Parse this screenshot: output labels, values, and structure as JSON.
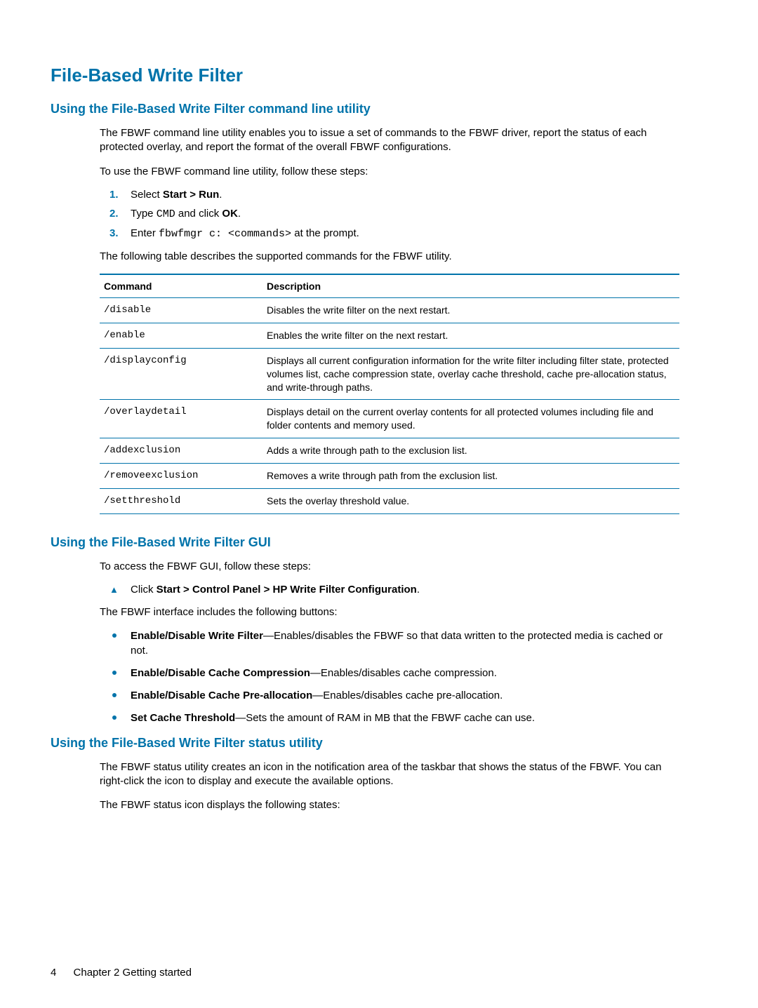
{
  "title": "File-Based Write Filter",
  "section1": {
    "heading": "Using the File-Based Write Filter command line utility",
    "intro": "The FBWF command line utility enables you to issue a set of commands to the FBWF driver, report the status of each protected overlay, and report the format of the overall FBWF configurations.",
    "lead": "To use the FBWF command line utility, follow these steps:",
    "steps": {
      "s1_a": "Select ",
      "s1_b": "Start > Run",
      "s1_c": ".",
      "s2_a": "Type ",
      "s2_code": "CMD",
      "s2_b": " and click ",
      "s2_bold": "OK",
      "s2_c": ".",
      "s3_a": "Enter ",
      "s3_code": "fbwfmgr c: <commands>",
      "s3_b": " at the prompt."
    },
    "table_lead": "The following table describes the supported commands for the FBWF utility.",
    "table": {
      "h1": "Command",
      "h2": "Description",
      "rows": [
        {
          "cmd": "/disable",
          "desc": "Disables the write filter on the next restart."
        },
        {
          "cmd": "/enable",
          "desc": "Enables the write filter on the next restart."
        },
        {
          "cmd": "/displayconfig",
          "desc": "Displays all current configuration information for the write filter including filter state, protected volumes list, cache compression state, overlay cache threshold, cache pre-allocation status, and write-through paths."
        },
        {
          "cmd": "/overlaydetail",
          "desc": "Displays detail on the current overlay contents for all protected volumes including file and folder contents and memory used."
        },
        {
          "cmd": "/addexclusion",
          "desc": "Adds a write through path to the exclusion list."
        },
        {
          "cmd": "/removeexclusion",
          "desc": "Removes a write through path from the exclusion list."
        },
        {
          "cmd": "/setthreshold",
          "desc": "Sets the overlay threshold value."
        }
      ]
    }
  },
  "section2": {
    "heading": "Using the File-Based Write Filter GUI",
    "intro": "To access the FBWF GUI, follow these steps:",
    "tri": {
      "a": "Click ",
      "b": "Start > Control Panel > HP Write Filter Configuration",
      "c": "."
    },
    "lead2": "The FBWF interface includes the following buttons:",
    "bullets": [
      {
        "b": "Enable/Disable Write Filter",
        "t": "—Enables/disables the FBWF so that data written to the protected media is cached or not."
      },
      {
        "b": "Enable/Disable Cache Compression",
        "t": "—Enables/disables cache compression."
      },
      {
        "b": "Enable/Disable Cache Pre-allocation",
        "t": "—Enables/disables cache pre-allocation."
      },
      {
        "b": "Set Cache Threshold",
        "t": "—Sets the amount of RAM in MB that the FBWF cache can use."
      }
    ]
  },
  "section3": {
    "heading": "Using the File-Based Write Filter status utility",
    "p1": "The FBWF status utility creates an icon in the notification area of the taskbar that shows the status of the FBWF. You can right-click the icon to display and execute the available options.",
    "p2": "The FBWF status icon displays the following states:"
  },
  "footer": {
    "page": "4",
    "chapter": "Chapter 2   Getting started"
  }
}
